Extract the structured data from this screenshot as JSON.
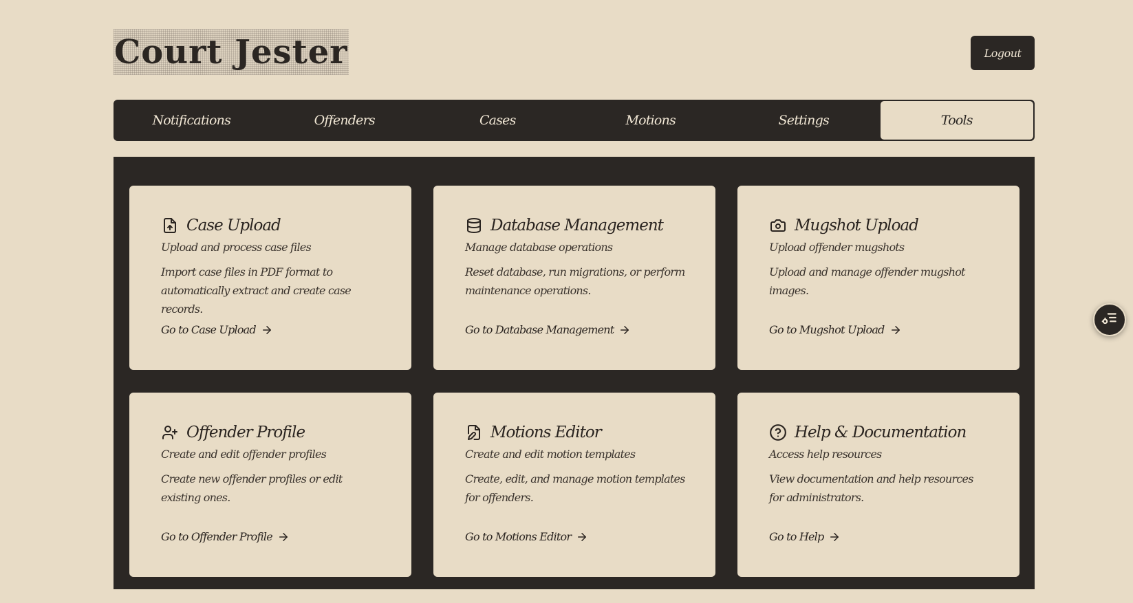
{
  "app": {
    "logo_text": "Court Jester",
    "logout_label": "Logout"
  },
  "nav": {
    "tabs": [
      {
        "label": "Notifications",
        "active": false
      },
      {
        "label": "Offenders",
        "active": false
      },
      {
        "label": "Cases",
        "active": false
      },
      {
        "label": "Motions",
        "active": false
      },
      {
        "label": "Settings",
        "active": false
      },
      {
        "label": "Tools",
        "active": true
      }
    ]
  },
  "cards": [
    {
      "icon": "file-upload-icon",
      "title": "Case Upload",
      "subtitle": "Upload and process case files",
      "description": "Import case files in PDF format to automatically extract and create case records.",
      "link": "Go to Case Upload"
    },
    {
      "icon": "database-icon",
      "title": "Database Management",
      "subtitle": "Manage database operations",
      "description": "Reset database, run migrations, or perform maintenance operations.",
      "link": "Go to Database Management"
    },
    {
      "icon": "camera-icon",
      "title": "Mugshot Upload",
      "subtitle": "Upload offender mugshots",
      "description": "Upload and manage offender mugshot images.",
      "link": "Go to Mugshot Upload"
    },
    {
      "icon": "user-plus-icon",
      "title": "Offender Profile",
      "subtitle": "Create and edit offender profiles",
      "description": "Create new offender profiles or edit existing ones.",
      "link": "Go to Offender Profile"
    },
    {
      "icon": "file-edit-icon",
      "title": "Motions Editor",
      "subtitle": "Create and edit motion templates",
      "description": "Create, edit, and manage motion templates for offenders.",
      "link": "Go to Motions Editor"
    },
    {
      "icon": "help-circle-icon",
      "title": "Help & Documentation",
      "subtitle": "Access help resources",
      "description": "View documentation and help resources for administrators.",
      "link": "Go to Help"
    }
  ],
  "colors": {
    "background": "#e8dcc6",
    "dark": "#2b2724",
    "text": "#2a2420"
  },
  "floating_button": {
    "icon": "settings-list-icon"
  }
}
